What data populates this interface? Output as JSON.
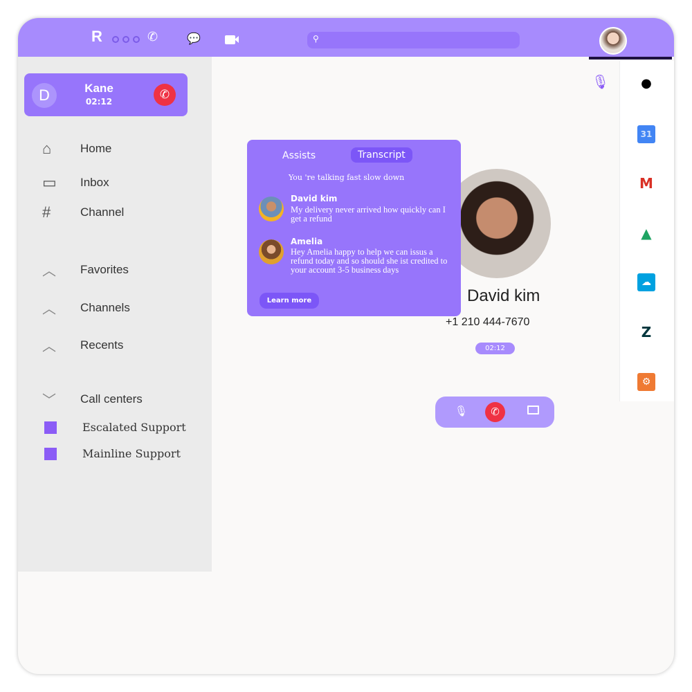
{
  "header": {
    "logo": "R",
    "search_placeholder": "",
    "icons": [
      "logo-icon",
      "more-icon",
      "phone-icon",
      "chat-icon",
      "video-icon",
      "search-icon"
    ]
  },
  "active_call": {
    "initial": "D",
    "name": "Kane",
    "time": "02:12"
  },
  "nav": [
    {
      "label": "Home",
      "icon": "home-icon"
    },
    {
      "label": "Inbox",
      "icon": "inbox-icon"
    },
    {
      "label": "Channel",
      "icon": "hash-icon"
    }
  ],
  "sections": [
    {
      "label": "Favorites",
      "state": "collapsed"
    },
    {
      "label": "Channels",
      "state": "collapsed"
    },
    {
      "label": "Recents",
      "state": "collapsed"
    },
    {
      "label": "Call centers",
      "state": "expanded"
    }
  ],
  "call_centers": [
    "Escalated Support",
    "Mainline Support"
  ],
  "assist_panel": {
    "tabs": [
      "Assists",
      "Transcript"
    ],
    "active_tab": "Transcript",
    "warning": "You 're talking fast slow down",
    "messages": [
      {
        "name": "David kim",
        "text": "My delivery never arrived how quickly can I get a refund"
      },
      {
        "name": "Amelia",
        "text": "Hey Amelia  happy to help we can issus a refund today and so should she ist credited to your account 3-5 business days"
      }
    ],
    "learn_more": "Learn more"
  },
  "contact": {
    "name": "David kim",
    "phone": "+1 210 444-7670",
    "duration": "02:12"
  },
  "apps": [
    {
      "name": "contacts",
      "glyph": "👤",
      "color": "#000000"
    },
    {
      "name": "google-calendar",
      "glyph": "31",
      "color": "#4285f4"
    },
    {
      "name": "gmail",
      "glyph": "M",
      "color": "#d93025"
    },
    {
      "name": "google-drive",
      "glyph": "▲",
      "color": "#1fa463"
    },
    {
      "name": "salesforce",
      "glyph": "☁",
      "color": "#00a1e0"
    },
    {
      "name": "zendesk",
      "glyph": "Z",
      "color": "#03363d"
    },
    {
      "name": "hubspot",
      "glyph": "⚙",
      "color": "#ff7a59"
    }
  ],
  "colors": {
    "accent": "#9775fb",
    "header": "#a78bfd",
    "end_call": "#ef3244"
  }
}
